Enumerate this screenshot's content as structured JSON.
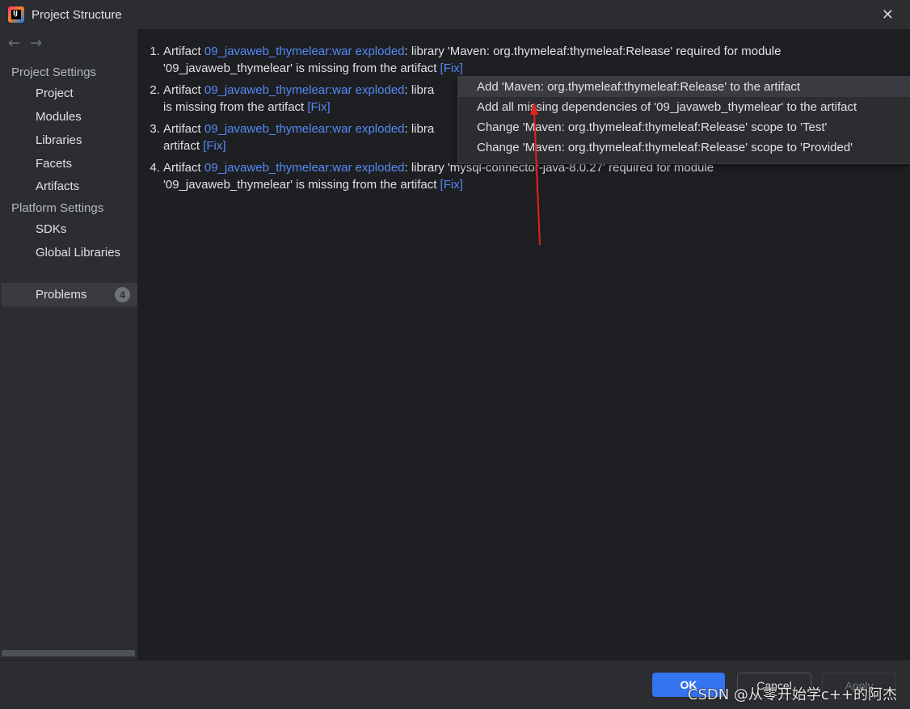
{
  "window": {
    "title": "Project Structure",
    "close_glyph": "✕"
  },
  "sidebar": {
    "back_glyph": "←",
    "forward_glyph": "→",
    "project_settings_header": "Project Settings",
    "project_items": [
      "Project",
      "Modules",
      "Libraries",
      "Facets",
      "Artifacts"
    ],
    "platform_settings_header": "Platform Settings",
    "platform_items": [
      "SDKs",
      "Global Libraries"
    ],
    "problems_label": "Problems",
    "problems_count": "4"
  },
  "problems": [
    {
      "prefix": "Artifact ",
      "artifact": "09_javaweb_thymelear:war exploded",
      "line1_rest": ": library 'Maven: org.thymeleaf:thymeleaf:Release' required for module",
      "line2": "'09_javaweb_thymelear' is missing from the artifact ",
      "fix": "[Fix]"
    },
    {
      "prefix": "Artifact ",
      "artifact": "09_javaweb_thymelear:war exploded",
      "line1_rest": ": libra",
      "line2": "is missing from the artifact ",
      "fix": "[Fix]"
    },
    {
      "prefix": "Artifact ",
      "artifact": "09_javaweb_thymelear:war exploded",
      "line1_rest": ": libra",
      "line2": "artifact ",
      "fix": "[Fix]"
    },
    {
      "prefix": "Artifact ",
      "artifact": "09_javaweb_thymelear:war exploded",
      "line1_rest": ": library 'mysql-connector-java-8.0.27' required for module",
      "line2": "'09_javaweb_thymelear' is missing from the artifact ",
      "fix": "[Fix]"
    }
  ],
  "fix_popup": {
    "items": [
      "Add 'Maven: org.thymeleaf:thymeleaf:Release' to the artifact",
      "Add all missing dependencies of '09_javaweb_thymelear' to the artifact",
      "Change 'Maven: org.thymeleaf:thymeleaf:Release' scope to 'Test'",
      "Change 'Maven: org.thymeleaf:thymeleaf:Release' scope to 'Provided'"
    ],
    "selected_index": 0
  },
  "footer": {
    "ok_label": "OK",
    "cancel_label": "Cancel",
    "apply_label": "Apply"
  },
  "watermark": "CSDN @从零开始学c++的阿杰",
  "colors": {
    "accent": "#3574f0",
    "link": "#548af7",
    "annotation_arrow": "#e8211d"
  }
}
